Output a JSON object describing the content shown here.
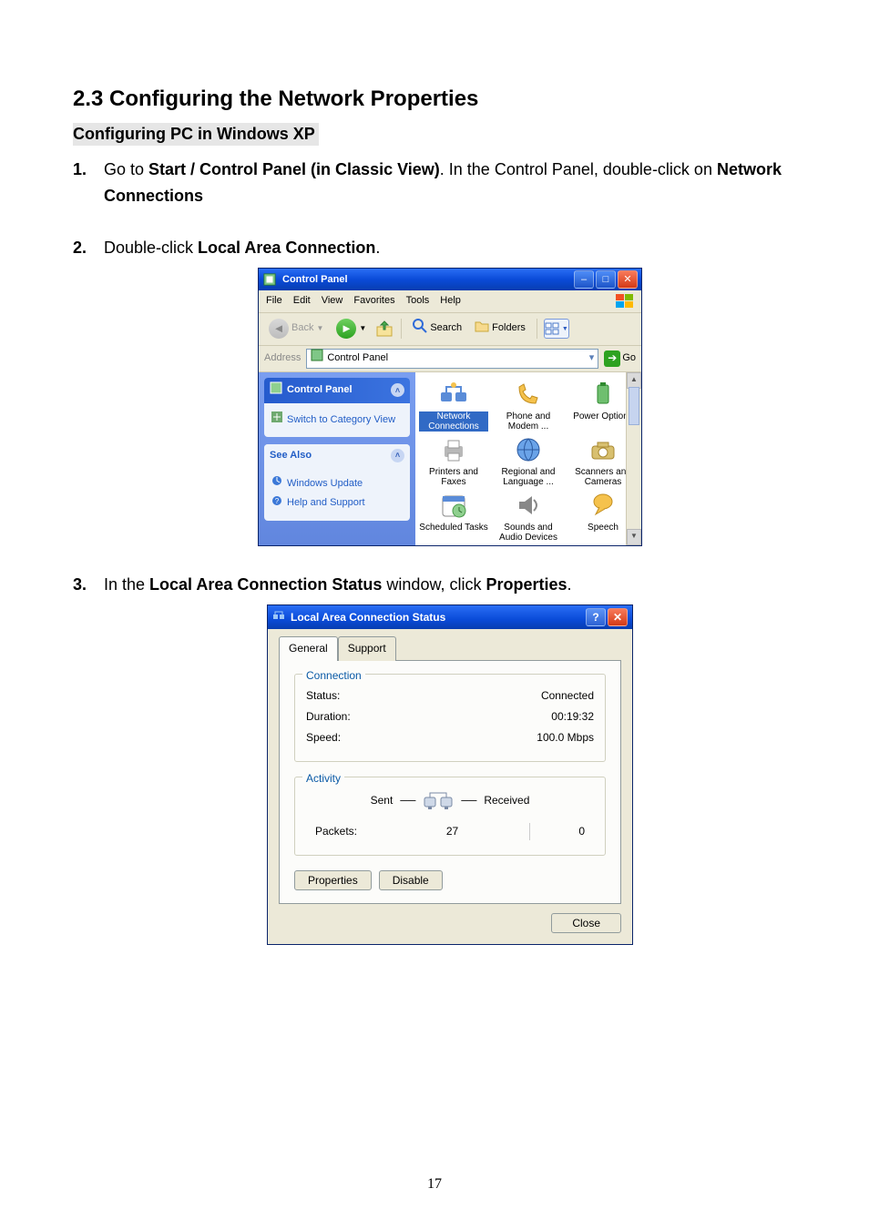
{
  "doc": {
    "section_title": "2.3 Configuring the Network Properties",
    "subheading": "Configuring PC in Windows XP",
    "page_number": "17",
    "steps": {
      "s1": {
        "num": "1.",
        "lead": "Go to ",
        "bold": "Start / Control Panel (in Classic View)",
        "mid": ". In the Control Panel, double-click on ",
        "bold2": "Network Connections"
      },
      "s2": {
        "num": "2.",
        "lead": "Double-click ",
        "bold": "Local Area Connection",
        "tail": "."
      },
      "s3": {
        "num": "3.",
        "lead": "In the ",
        "bold": "Local Area Connection Status",
        "mid": " window, click ",
        "bold2": "Properties",
        "tail": "."
      }
    }
  },
  "fig1": {
    "title": "Control Panel",
    "menus": {
      "file": "File",
      "edit": "Edit",
      "view": "View",
      "favorites": "Favorites",
      "tools": "Tools",
      "help": "Help"
    },
    "toolbar": {
      "back": "Back",
      "search": "Search",
      "folders": "Folders"
    },
    "addressbar": {
      "label": "Address",
      "value": "Control Panel",
      "go": "Go"
    },
    "sidebar": {
      "group1": {
        "title": "Control Panel",
        "link": "Switch to Category View"
      },
      "group2": {
        "title": "See Also",
        "link1": "Windows Update",
        "link2": "Help and Support"
      }
    },
    "items": [
      {
        "label": "Network Connections",
        "selected": true
      },
      {
        "label": "Phone and Modem ..."
      },
      {
        "label": "Power Options"
      },
      {
        "label": "Printers and Faxes"
      },
      {
        "label": "Regional and Language ..."
      },
      {
        "label": "Scanners and Cameras"
      },
      {
        "label": "Scheduled Tasks"
      },
      {
        "label": "Sounds and Audio Devices"
      },
      {
        "label": "Speech"
      }
    ]
  },
  "fig2": {
    "title": "Local Area Connection Status",
    "tabs": {
      "general": "General",
      "support": "Support"
    },
    "connection": {
      "legend": "Connection",
      "status_label": "Status:",
      "status_value": "Connected",
      "duration_label": "Duration:",
      "duration_value": "00:19:32",
      "speed_label": "Speed:",
      "speed_value": "100.0 Mbps"
    },
    "activity": {
      "legend": "Activity",
      "sent": "Sent",
      "received": "Received",
      "packets_label": "Packets:",
      "packets_sent": "27",
      "packets_recv": "0"
    },
    "buttons": {
      "properties": "Properties",
      "disable": "Disable",
      "close": "Close"
    }
  }
}
